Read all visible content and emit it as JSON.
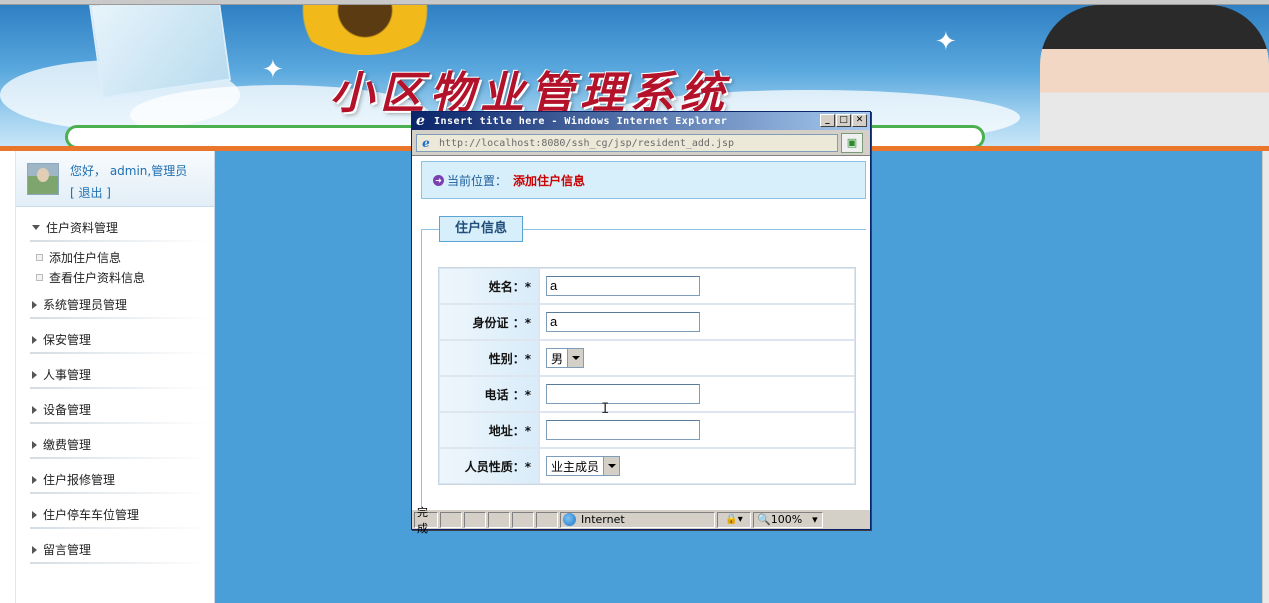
{
  "banner": {
    "title": "小区物业管理系统"
  },
  "sidebar": {
    "greeting": "您好， admin,管理员",
    "logout": "[ 退出 ]",
    "groups": [
      {
        "label": "住户资料管理",
        "expanded": true,
        "items": [
          "添加住户信息",
          "查看住户资料信息"
        ]
      },
      {
        "label": "系统管理员管理",
        "expanded": false
      },
      {
        "label": "保安管理",
        "expanded": false
      },
      {
        "label": "人事管理",
        "expanded": false
      },
      {
        "label": "设备管理",
        "expanded": false
      },
      {
        "label": "缴费管理",
        "expanded": false
      },
      {
        "label": "住户报修管理",
        "expanded": false
      },
      {
        "label": "住户停车车位管理",
        "expanded": false
      },
      {
        "label": "留言管理",
        "expanded": false
      }
    ]
  },
  "popup": {
    "title": "Insert title here - Windows Internet Explorer",
    "window_buttons": {
      "minimize": "_",
      "maximize": "□",
      "close": "✕"
    },
    "address": "http://localhost:8080/ssh_cg/jsp/resident_add.jsp",
    "location_label": "当前位置：",
    "location_value": "添加住户信息",
    "legend": "住户信息",
    "form": {
      "name_label": "姓名：*",
      "name_value": "a",
      "id_label": "身份证 ：*",
      "id_value": "a",
      "gender_label": "性别：*",
      "gender_value": "男",
      "phone_label": "电话 ：*",
      "phone_value": "",
      "address_label": "地址：*",
      "address_value": "",
      "type_label": "人员性质：*",
      "type_value": "业主成员"
    },
    "status": {
      "done": "完成",
      "zone": "Internet",
      "zoom": "100%"
    }
  },
  "colors": {
    "page_bg": "#4a9fd9",
    "location_value": "#cc0000",
    "titlebar_start": "#0a246a"
  }
}
